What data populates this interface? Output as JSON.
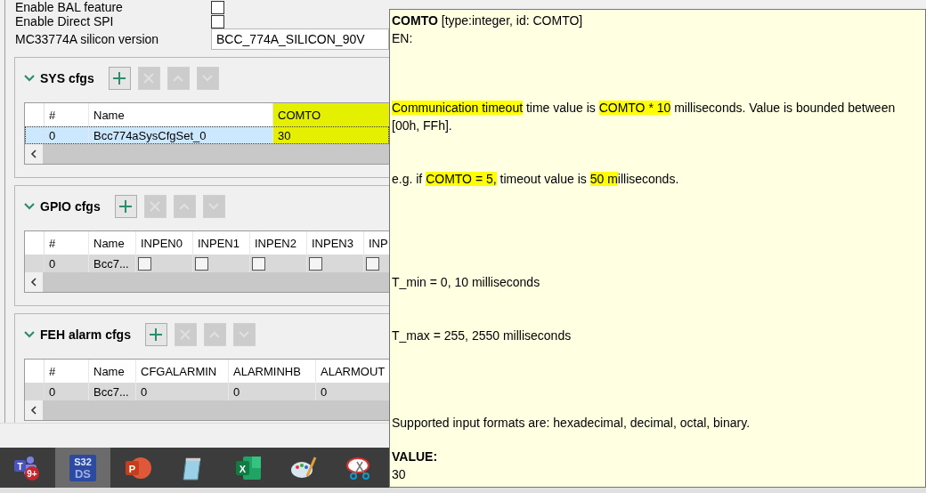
{
  "properties": [
    {
      "label": "Enable BAL feature",
      "kind": "checkbox",
      "checked": false
    },
    {
      "label": "Enable Direct SPI",
      "kind": "checkbox",
      "checked": false
    },
    {
      "label": "MC33774A silicon version",
      "kind": "field",
      "value": "BCC_774A_SILICON_90V"
    }
  ],
  "sections": [
    {
      "title": "SYS cfgs",
      "expanded": true,
      "buttons": [
        {
          "kind": "add",
          "disabled": false
        },
        {
          "kind": "delete",
          "disabled": true
        },
        {
          "kind": "up",
          "disabled": true
        },
        {
          "kind": "down",
          "disabled": true
        }
      ],
      "columns": [
        {
          "label": "#",
          "highlighted": false
        },
        {
          "label": "Name",
          "highlighted": false
        },
        {
          "label": "COMTO",
          "highlighted": true
        }
      ],
      "rows": [
        {
          "selected": true,
          "cells": [
            {
              "kind": "text",
              "text": "0",
              "highlighted": false
            },
            {
              "kind": "text",
              "text": "Bcc774aSysCfgSet_0",
              "highlighted": false
            },
            {
              "kind": "text",
              "text": "30",
              "highlighted": true
            }
          ]
        }
      ]
    },
    {
      "title": "GPIO cfgs",
      "expanded": true,
      "buttons": [
        {
          "kind": "add",
          "disabled": false
        },
        {
          "kind": "delete",
          "disabled": true
        },
        {
          "kind": "up",
          "disabled": true
        },
        {
          "kind": "down",
          "disabled": true
        }
      ],
      "columns": [
        {
          "label": "#",
          "highlighted": false
        },
        {
          "label": "Name",
          "highlighted": false
        },
        {
          "label": "INPEN0",
          "highlighted": false
        },
        {
          "label": "INPEN1",
          "highlighted": false
        },
        {
          "label": "INPEN2",
          "highlighted": false
        },
        {
          "label": "INPEN3",
          "highlighted": false
        },
        {
          "label": "INP",
          "highlighted": false
        }
      ],
      "rows": [
        {
          "selected": false,
          "cells": [
            {
              "kind": "text",
              "text": "0",
              "highlighted": false
            },
            {
              "kind": "text",
              "text": "Bcc7...",
              "highlighted": false
            },
            {
              "kind": "checkbox",
              "checked": false
            },
            {
              "kind": "checkbox",
              "checked": false
            },
            {
              "kind": "checkbox",
              "checked": false
            },
            {
              "kind": "checkbox",
              "checked": false
            },
            {
              "kind": "checkbox",
              "checked": false
            }
          ]
        }
      ]
    },
    {
      "title": "FEH alarm cfgs",
      "expanded": true,
      "buttons": [
        {
          "kind": "add",
          "disabled": false
        },
        {
          "kind": "delete",
          "disabled": true
        },
        {
          "kind": "up",
          "disabled": true
        },
        {
          "kind": "down",
          "disabled": true
        }
      ],
      "columns": [
        {
          "label": "#",
          "highlighted": false
        },
        {
          "label": "Name",
          "highlighted": false
        },
        {
          "label": "CFGALARMIN",
          "highlighted": false
        },
        {
          "label": "ALARMINHB",
          "highlighted": false
        },
        {
          "label": "ALARMOUT",
          "highlighted": false
        }
      ],
      "rows": [
        {
          "selected": false,
          "cells": [
            {
              "kind": "text",
              "text": "0",
              "highlighted": false
            },
            {
              "kind": "text",
              "text": "Bcc7...",
              "highlighted": false
            },
            {
              "kind": "text",
              "text": "0",
              "highlighted": false
            },
            {
              "kind": "text",
              "text": "0",
              "highlighted": false
            },
            {
              "kind": "text",
              "text": "0",
              "highlighted": false
            }
          ]
        }
      ]
    }
  ],
  "tooltip": {
    "blocks": [
      {
        "segments": [
          {
            "text": "COMTO",
            "highlighted": false,
            "bold": true
          },
          {
            "text": " [type:integer, id: COMTO]",
            "highlighted": false,
            "bold": false
          }
        ]
      },
      {
        "segments": [
          {
            "text": "EN:",
            "highlighted": false,
            "bold": false
          }
        ]
      },
      {
        "segments": [
          {
            "text": " Communication timeout",
            "highlighted": true,
            "bold": false
          },
          {
            "text": " time value is ",
            "highlighted": false,
            "bold": false
          },
          {
            "text": "COMTO * 10",
            "highlighted": true,
            "bold": false
          },
          {
            "text": " milliseconds. Value is bounded between [00h, FFh].",
            "highlighted": false,
            "bold": false
          }
        ]
      },
      {
        "segments": [
          {
            "text": " e.g. if ",
            "highlighted": false,
            "bold": false
          },
          {
            "text": "COMTO = 5,",
            "highlighted": true,
            "bold": false
          },
          {
            "text": " timeout value is ",
            "highlighted": false,
            "bold": false
          },
          {
            "text": "50 m",
            "highlighted": true,
            "bold": false
          },
          {
            "text": "illiseconds.",
            "highlighted": false,
            "bold": false
          }
        ]
      },
      {
        "segments": [
          {
            "text": " T_min = 0, 10 milliseconds",
            "highlighted": false,
            "bold": false
          }
        ]
      },
      {
        "segments": [
          {
            "text": " T_max = 255, 2550 milliseconds",
            "highlighted": false,
            "bold": false
          }
        ]
      },
      {
        "segments": [
          {
            "text": "Supported input formats are: hexadecimal, decimal, octal, binary.",
            "highlighted": false,
            "bold": false
          }
        ]
      },
      {
        "segments": [
          {
            "text": "VALUE:",
            "highlighted": false,
            "bold": true
          }
        ]
      },
      {
        "segments": [
          {
            "text": "30",
            "highlighted": false,
            "bold": false
          }
        ]
      }
    ]
  },
  "taskbar": [
    {
      "kind": "teams",
      "label": "T",
      "badge": "9+",
      "active": false
    },
    {
      "kind": "ide",
      "label": "S32",
      "badge": "DS",
      "active": true
    },
    {
      "kind": "powerpoint",
      "label": "P",
      "active": false
    },
    {
      "kind": "notepad",
      "active": false
    },
    {
      "kind": "excel",
      "label": "X",
      "active": false
    },
    {
      "kind": "paint",
      "active": false
    },
    {
      "kind": "snipping",
      "active": false
    }
  ]
}
